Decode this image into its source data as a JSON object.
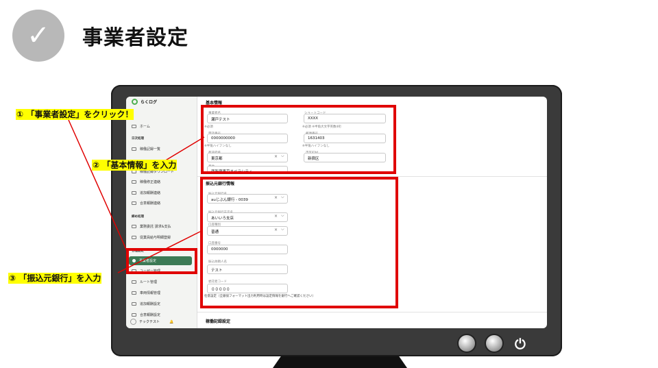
{
  "header": {
    "check_mark": "✓",
    "title": "事業者設定"
  },
  "callouts": {
    "c1": "① 「事業者設定」をクリック！",
    "c2": "② 「基本情報」を入力",
    "c3": "③ 「振込元銀行」を入力"
  },
  "sidebar": {
    "logo": "らくログ",
    "items": {
      "home": "ホーム",
      "sec_daily": "日次処理",
      "work_report": "稼働記録一覧",
      "hidden": "稼働記録ダウンロード",
      "correction": "稼働修正連絡",
      "additional": "追加報酬連絡",
      "merge": "合意報酬連絡",
      "sec_monthly": "締め処理",
      "invoice": "業務委託 請求&支払",
      "payslip": "従業員給与明細登録",
      "sec_settings": "各種設定",
      "business": "事業者設定",
      "user_mgmt": "ユーザー管理",
      "route": "ルート管理",
      "vehicle": "車両情報管理",
      "add_reward": "追加報酬設定",
      "agree_reward": "合意報酬設定"
    },
    "user": "テックテスト"
  },
  "basic": {
    "heading": "基本情報",
    "business_name_label": "事業者名",
    "business_name": "瀬戸テスト",
    "short_code_label": "ショートコード",
    "short_code": "XXXX",
    "required": "※必須",
    "short_code_hint": "※必須 ※半角大文字英数4桁",
    "phone_label": "電話番号",
    "phone": "0000000000",
    "zip_label": "郵便番号",
    "zip": "1631403",
    "nohyphen": "※半角ハイフンなし",
    "pref_label": "都道府県",
    "pref": "東京都",
    "city_label": "市区町村",
    "city": "新宿区",
    "addr_label": "番地",
    "addr": "西新宿東京オペラシティ"
  },
  "bank": {
    "heading": "振込元銀行情報",
    "bank_label": "振込元銀行名",
    "bank": "auじぶん銀行 - 0039",
    "branch_label": "振込元銀行支店名",
    "branch": "あいいろ支店",
    "acct_type_label": "口座種別",
    "acct_type": "普通",
    "acct_no_label": "口座番号",
    "acct_no": "0000000",
    "holder_label": "振込依頼人名",
    "holder": "テスト",
    "client_code_label": "委託者コード",
    "client_code": "０００００",
    "note": "任意設定（全銀協フォーマット出力利用時は設定情報を銀行へご確認ください）",
    "next_heading": "稼働記録設定"
  },
  "controls": {
    "clear": "×",
    "chevron": "⌵",
    "power": "⏻"
  }
}
